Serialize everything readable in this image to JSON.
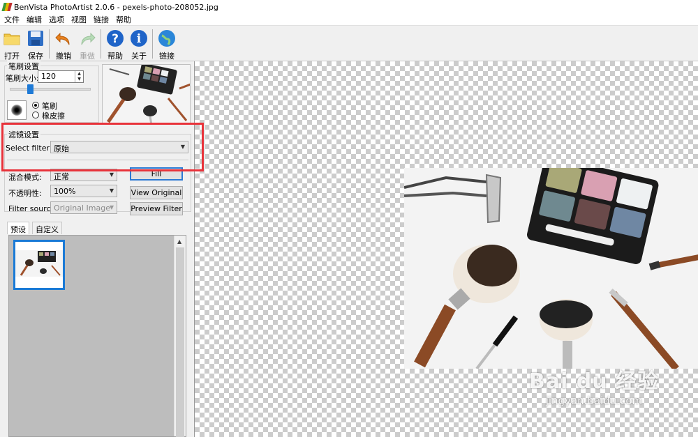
{
  "window": {
    "title": "BenVista PhotoArtist 2.0.6 - pexels-photo-208052.jpg"
  },
  "menu": [
    "文件",
    "编辑",
    "选项",
    "视图",
    "链接",
    "帮助"
  ],
  "toolbar": {
    "open": "打开",
    "save": "保存",
    "undo": "撤销",
    "redo": "重做",
    "help": "帮助",
    "about": "关于",
    "link": "链接"
  },
  "brush": {
    "group_title": "笔刷设置",
    "size_label": "笔刷大小:",
    "size_value": "120",
    "mode_brush": "笔刷",
    "mode_eraser": "橡皮擦",
    "slider_level": 0.25
  },
  "filter": {
    "group_title": "滤镜设置",
    "select_label": "Select filter:",
    "select_value": "原始",
    "blend_label": "混合模式:",
    "blend_value": "正常",
    "opacity_label": "不透明性:",
    "opacity_value": "100%",
    "source_label": "Filter source:",
    "source_value": "Original Image",
    "fill_button": "Fill",
    "view_original_button": "View Original",
    "preview_filter_button": "Preview Filter"
  },
  "tabs": {
    "preset": "预设",
    "custom": "自定义"
  },
  "watermark": {
    "main": "Bai du 经验",
    "sub": "jingyan.baidu.com"
  },
  "colors": {
    "highlight": "#e8323a",
    "accent": "#1e7ad6"
  }
}
